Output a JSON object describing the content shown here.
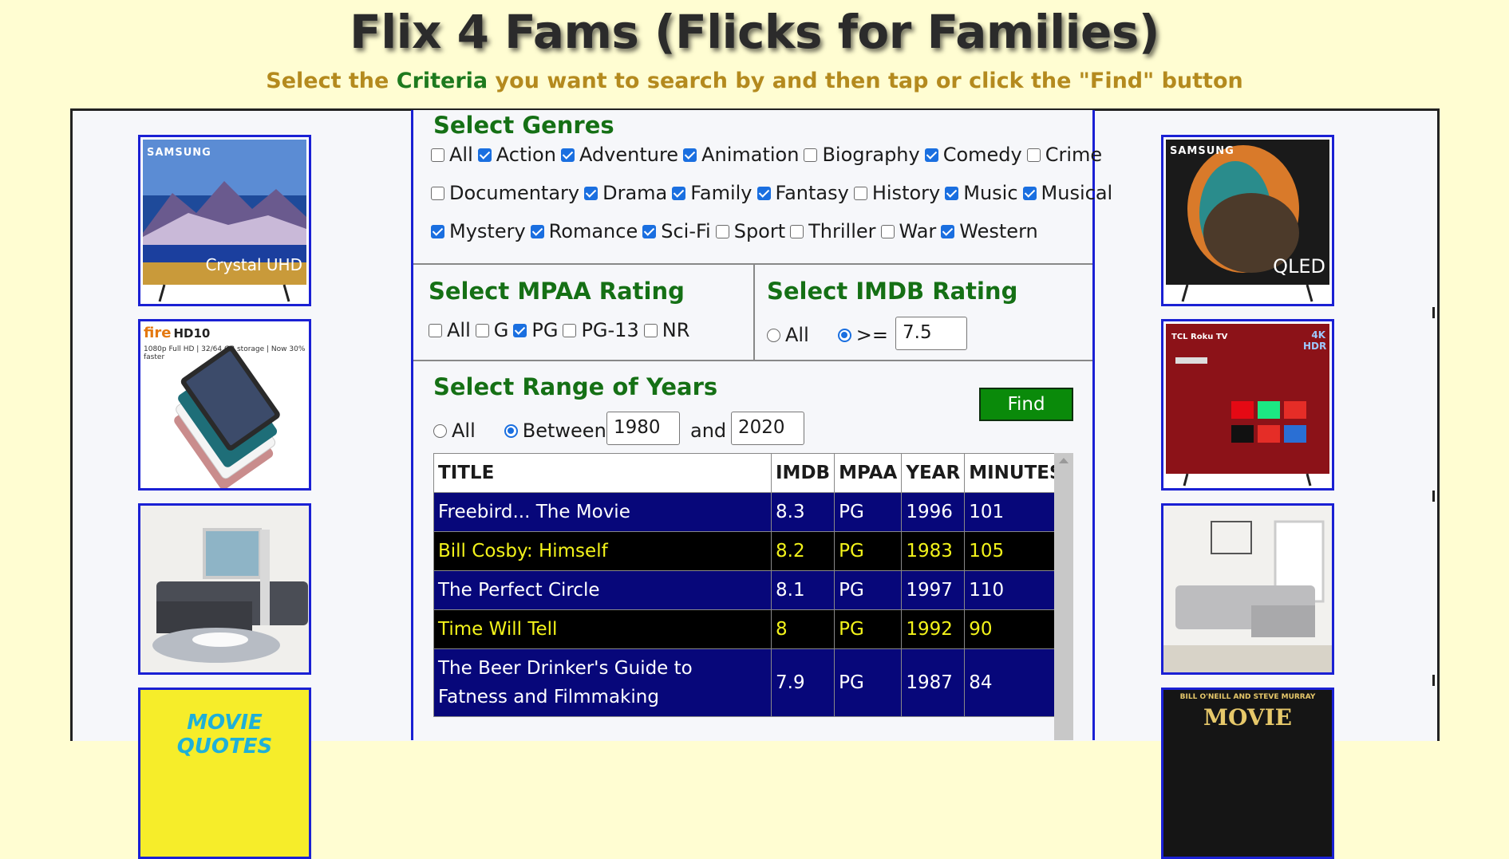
{
  "header": {
    "title": "Flix 4 Fams (Flicks for Families)",
    "subtitle_before": "Select the ",
    "subtitle_highlight": "Criteria",
    "subtitle_after": " you want to search by and then tap or click the \"Find\" button"
  },
  "genres": {
    "title": "Select Genres",
    "rows": [
      [
        {
          "label": "All",
          "checked": false
        },
        {
          "label": "Action",
          "checked": true
        },
        {
          "label": "Adventure",
          "checked": true
        },
        {
          "label": "Animation",
          "checked": true
        },
        {
          "label": "Biography",
          "checked": false
        },
        {
          "label": "Comedy",
          "checked": true
        },
        {
          "label": "Crime",
          "checked": false
        }
      ],
      [
        {
          "label": "Documentary",
          "checked": false
        },
        {
          "label": "Drama",
          "checked": true
        },
        {
          "label": "Family",
          "checked": true
        },
        {
          "label": "Fantasy",
          "checked": true
        },
        {
          "label": "History",
          "checked": false
        },
        {
          "label": "Music",
          "checked": true
        },
        {
          "label": "Musical",
          "checked": true
        }
      ],
      [
        {
          "label": "Mystery",
          "checked": true
        },
        {
          "label": "Romance",
          "checked": true
        },
        {
          "label": "Sci-Fi",
          "checked": true
        },
        {
          "label": "Sport",
          "checked": false
        },
        {
          "label": "Thriller",
          "checked": false
        },
        {
          "label": "War",
          "checked": false
        },
        {
          "label": "Western",
          "checked": true
        }
      ]
    ]
  },
  "mpaa": {
    "title": "Select MPAA Rating",
    "options": [
      {
        "label": "All",
        "checked": false
      },
      {
        "label": "G",
        "checked": false
      },
      {
        "label": "PG",
        "checked": true
      },
      {
        "label": "PG-13",
        "checked": false
      },
      {
        "label": "NR",
        "checked": false
      }
    ]
  },
  "imdb": {
    "title": "Select IMDB Rating",
    "all_label": "All",
    "gte_label": ">=",
    "selected": "gte",
    "value": "7.5"
  },
  "years": {
    "title": "Select Range of Years",
    "all_label": "All",
    "between_label": "Between",
    "and_label": "and",
    "selected": "between",
    "from": "1980",
    "to": "2020"
  },
  "find_label": "Find",
  "table": {
    "headers": [
      "TITLE",
      "IMDB",
      "MPAA",
      "YEAR",
      "MINUTES"
    ],
    "rows": [
      {
        "title": "Freebird... The Movie",
        "imdb": "8.3",
        "mpaa": "PG",
        "year": "1996",
        "minutes": "101"
      },
      {
        "title": "Bill Cosby: Himself",
        "imdb": "8.2",
        "mpaa": "PG",
        "year": "1983",
        "minutes": "105"
      },
      {
        "title": "The Perfect Circle",
        "imdb": "8.1",
        "mpaa": "PG",
        "year": "1997",
        "minutes": "110"
      },
      {
        "title": "Time Will Tell",
        "imdb": "8",
        "mpaa": "PG",
        "year": "1992",
        "minutes": "90"
      },
      {
        "title": "The Beer Drinker's Guide to Fatness and Filmmaking",
        "imdb": "7.9",
        "mpaa": "PG",
        "year": "1987",
        "minutes": "84"
      }
    ]
  },
  "ads": {
    "left": [
      {
        "name": "samsung-crystal-uhd-tv-ad",
        "brand": "SAMSUNG",
        "caption": "Crystal UHD"
      },
      {
        "name": "fire-hd10-tablet-ad",
        "brand": "fire",
        "model": "HD10",
        "caption": "1080p Full HD | 32/64 GB storage | Now 30% faster"
      },
      {
        "name": "gray-sectional-sofa-ad"
      },
      {
        "name": "movie-quotes-book-ad",
        "caption": "MOVIE QUOTES"
      }
    ],
    "right": [
      {
        "name": "samsung-qled-tv-ad",
        "brand": "SAMSUNG",
        "caption": "QLED"
      },
      {
        "name": "tcl-roku-tv-ad",
        "brand": "TCL Roku TV",
        "badge": "4K HDR"
      },
      {
        "name": "light-gray-sectional-sofa-ad"
      },
      {
        "name": "movie-trivia-madness-book-ad",
        "author": "BILL O'NEILL AND STEVE MURRAY",
        "caption": "MOVIE"
      }
    ]
  }
}
